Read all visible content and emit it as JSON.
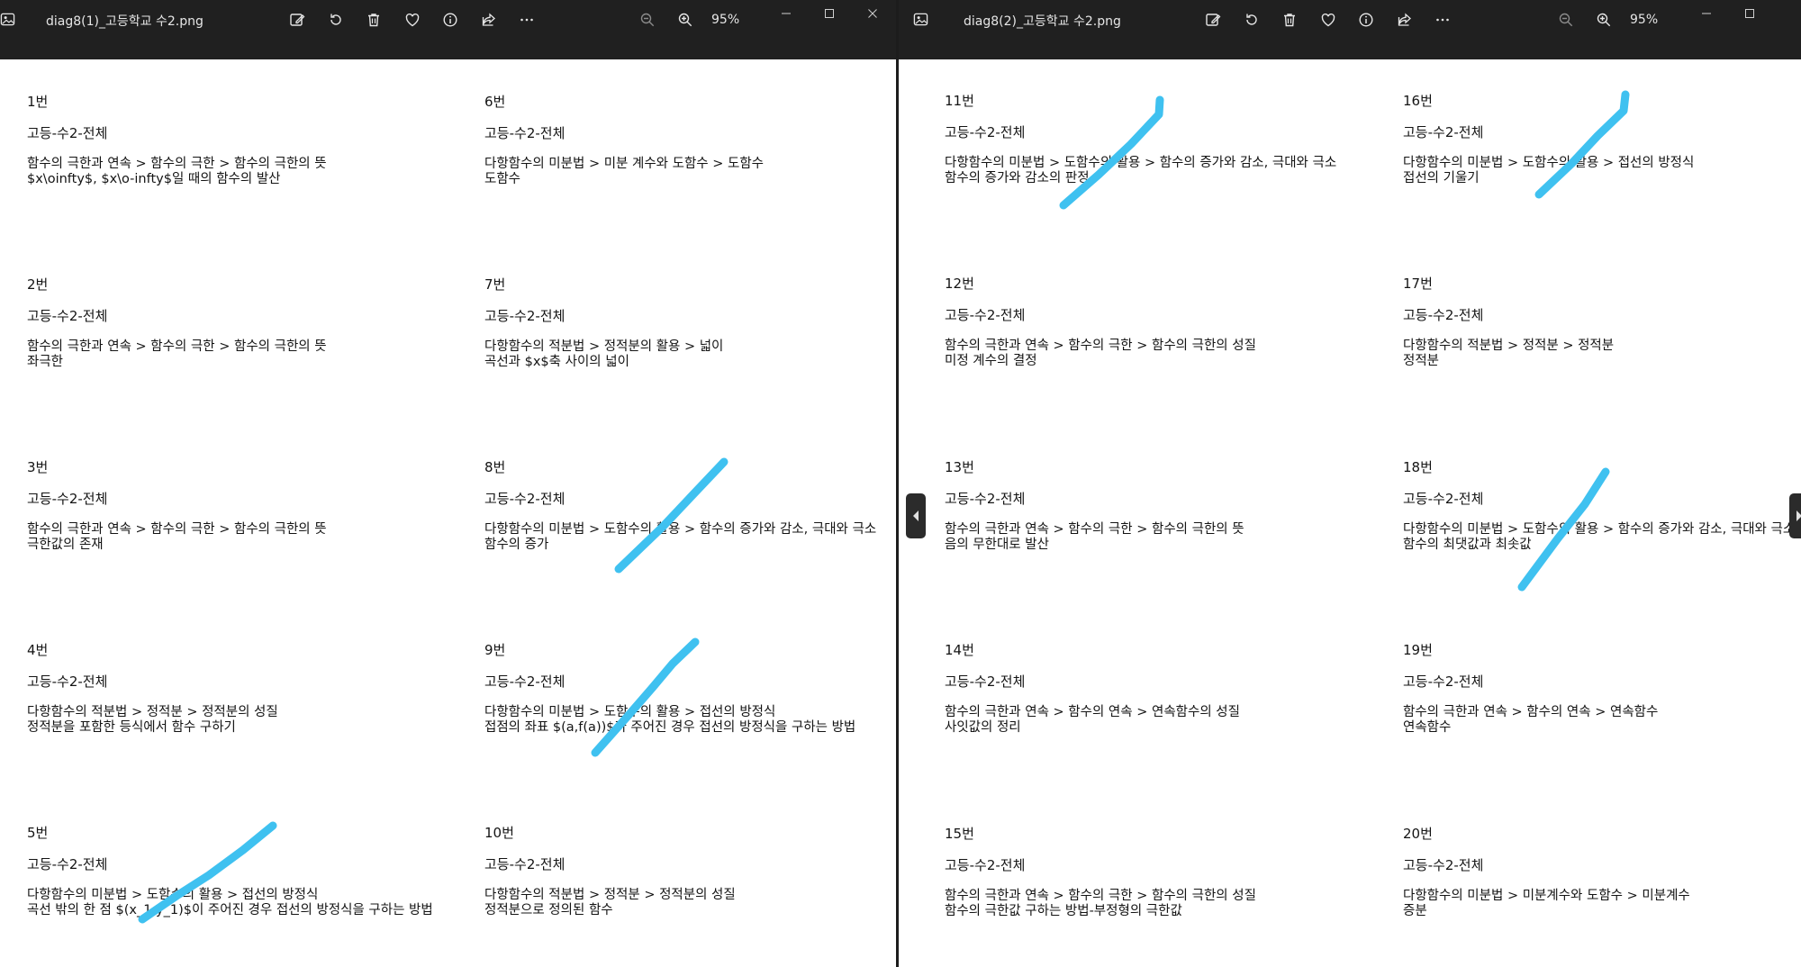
{
  "windows": [
    {
      "id": "left",
      "filename": "diag8(1)_고등학교 수2.png",
      "zoom": "95%",
      "items": [
        {
          "num": "1번",
          "level": "고등-수2-전체",
          "path": "함수의 극한과 연속 > 함수의 극한 > 함수의 극한의 뜻",
          "sub": "$x\\oinfty$, $x\\o-infty$일 때의 함수의 발산"
        },
        {
          "num": "2번",
          "level": "고등-수2-전체",
          "path": "함수의 극한과 연속 > 함수의 극한 > 함수의 극한의 뜻",
          "sub": "좌극한"
        },
        {
          "num": "3번",
          "level": "고등-수2-전체",
          "path": "함수의 극한과 연속 > 함수의 극한 > 함수의 극한의 뜻",
          "sub": "극한값의 존재"
        },
        {
          "num": "4번",
          "level": "고등-수2-전체",
          "path": "다항함수의 적분법 > 정적분 > 정적분의 성질",
          "sub": "정적분을 포함한 등식에서 함수 구하기"
        },
        {
          "num": "5번",
          "level": "고등-수2-전체",
          "path": "다항함수의 미분법 > 도함수의 활용 > 접선의 방정식",
          "sub": "곡선 밖의 한 점 $(x_1,y_1)$이 주어진 경우 접선의 방정식을 구하는 방법"
        },
        {
          "num": "6번",
          "level": "고등-수2-전체",
          "path": "다항함수의 미분법 > 미분 계수와 도함수 > 도함수",
          "sub": "도함수"
        },
        {
          "num": "7번",
          "level": "고등-수2-전체",
          "path": "다항함수의 적분법 > 정적분의 활용 > 넓이",
          "sub": "곡선과 $x$축 사이의 넓이"
        },
        {
          "num": "8번",
          "level": "고등-수2-전체",
          "path": "다항함수의 미분법 > 도함수의 활용 > 함수의 증가와 감소, 극대와 극소",
          "sub": "함수의 증가"
        },
        {
          "num": "9번",
          "level": "고등-수2-전체",
          "path": "다항함수의 미분법 > 도함수의 활용 > 접선의 방정식",
          "sub": "접점의 좌표 $(a,f(a))$가 주어진 경우 접선의 방정식을 구하는 방법"
        },
        {
          "num": "10번",
          "level": "고등-수2-전체",
          "path": "다항함수의 적분법 > 정적분 > 정적분의 성질",
          "sub": "정적분으로 정의된 함수"
        }
      ]
    },
    {
      "id": "right",
      "filename": "diag8(2)_고등학교 수2.png",
      "zoom": "95%",
      "items": [
        {
          "num": "11번",
          "level": "고등-수2-전체",
          "path": "다항함수의 미분법 > 도함수의 활용 > 함수의 증가와 감소, 극대와 극소",
          "sub": "함수의 증가와 감소의 판정"
        },
        {
          "num": "12번",
          "level": "고등-수2-전체",
          "path": "함수의 극한과 연속 > 함수의 극한 > 함수의 극한의 성질",
          "sub": "미정 계수의 결정"
        },
        {
          "num": "13번",
          "level": "고등-수2-전체",
          "path": "함수의 극한과 연속 > 함수의 극한 > 함수의 극한의 뜻",
          "sub": "음의 무한대로 발산"
        },
        {
          "num": "14번",
          "level": "고등-수2-전체",
          "path": "함수의 극한과 연속 > 함수의 연속 > 연속함수의 성질",
          "sub": "사잇값의 정리"
        },
        {
          "num": "15번",
          "level": "고등-수2-전체",
          "path": "함수의 극한과 연속 > 함수의 극한 > 함수의 극한의 성질",
          "sub": "함수의 극한값 구하는 방법-부정형의 극한값"
        },
        {
          "num": "16번",
          "level": "고등-수2-전체",
          "path": "다항함수의 미분법 > 도함수의 활용 > 접선의 방정식",
          "sub": "접선의 기울기"
        },
        {
          "num": "17번",
          "level": "고등-수2-전체",
          "path": "다항함수의 적분법 > 정적분 > 정적분",
          "sub": "정적분"
        },
        {
          "num": "18번",
          "level": "고등-수2-전체",
          "path": "다항함수의 미분법 > 도함수의 활용 > 함수의 증가와 감소, 극대와 극소",
          "sub": "함수의 최댓값과 최솟값"
        },
        {
          "num": "19번",
          "level": "고등-수2-전체",
          "path": "함수의 극한과 연속 > 함수의 연속 > 연속함수",
          "sub": "연속함수"
        },
        {
          "num": "20번",
          "level": "고등-수2-전체",
          "path": "다항함수의 미분법 > 미분계수와 도함수 > 미분계수",
          "sub": "증분"
        }
      ]
    }
  ],
  "toolbar_icons": [
    "edit-icon",
    "rotate-icon",
    "delete-icon",
    "favorite-icon",
    "info-icon",
    "share-icon",
    "more-icon"
  ],
  "zoom_icons": [
    "zoom-out-icon",
    "zoom-in-icon"
  ],
  "window_controls": [
    "minimize-icon",
    "maximize-icon",
    "close-icon"
  ],
  "colors": {
    "titlebar": "#202020",
    "highlight_stroke": "#3fc1f0",
    "page": "#ffffff",
    "text": "#141414"
  }
}
